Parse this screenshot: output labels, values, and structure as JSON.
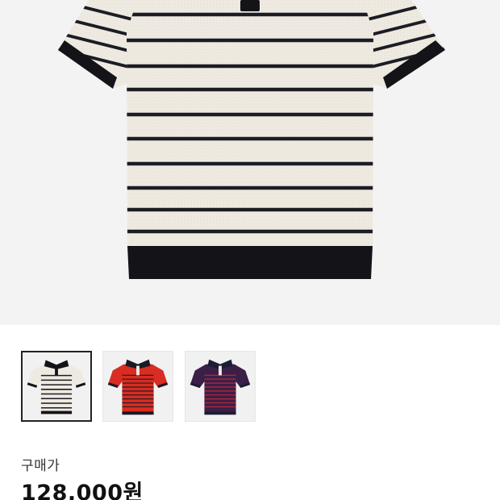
{
  "product": {
    "image_alt": "",
    "color_options": [
      {
        "name": "ivory-navy",
        "body": "#eeeae1",
        "stripe": "#1c1c24",
        "trim": "#141418",
        "selected": true
      },
      {
        "name": "red",
        "body": "#d92c22",
        "stripe": "#2a1a1f",
        "trim": "#1a1a26",
        "selected": false
      },
      {
        "name": "navy-red",
        "body": "#3a1f48",
        "stripe": "#b0253a",
        "trim": "#1c1c34",
        "selected": false
      }
    ]
  },
  "purchase": {
    "label": "구매가",
    "price": "128,000원"
  }
}
